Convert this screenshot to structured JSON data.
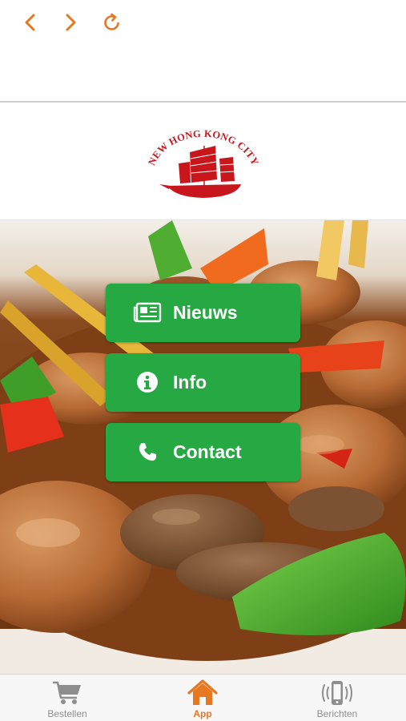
{
  "colors": {
    "accent": "#e87722",
    "button_green": "#26a843",
    "brand_red": "#c8161d",
    "tab_inactive": "#8e8e8e"
  },
  "browser_nav": {
    "back_icon": "chevron-left-icon",
    "forward_icon": "chevron-right-icon",
    "reload_icon": "reload-icon"
  },
  "logo": {
    "text": "NEW HONG KONG CITY"
  },
  "menu": {
    "items": [
      {
        "label": "Nieuws",
        "icon": "newspaper-icon"
      },
      {
        "label": "Info",
        "icon": "info-icon"
      },
      {
        "label": "Contact",
        "icon": "phone-icon"
      }
    ]
  },
  "tabbar": {
    "items": [
      {
        "label": "Bestellen",
        "icon": "cart-icon",
        "active": false
      },
      {
        "label": "App",
        "icon": "home-icon",
        "active": true
      },
      {
        "label": "Berichten",
        "icon": "vibrating-phone-icon",
        "active": false
      }
    ]
  }
}
